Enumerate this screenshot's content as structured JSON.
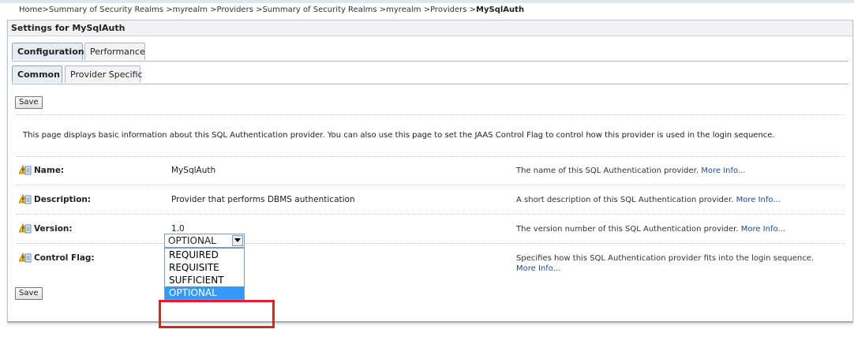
{
  "breadcrumb": {
    "items": [
      "Home",
      "Summary of Security Realms",
      "myrealm",
      "Providers",
      "Summary of Security Realms",
      "myrealm",
      "Providers"
    ],
    "separator": ">",
    "current": "MySqlAuth"
  },
  "panel": {
    "title": "Settings for MySqlAuth"
  },
  "tabs": {
    "primary": [
      {
        "label": "Configuration"
      },
      {
        "label": "Performance"
      }
    ],
    "secondary": [
      {
        "label": "Common"
      },
      {
        "label": "Provider Specific"
      }
    ]
  },
  "buttons": {
    "save_top": "Save",
    "save_bottom": "Save"
  },
  "intro": "This page displays basic information about this SQL Authentication provider. You can also use this page to set the JAAS Control Flag to control how this provider is used in the login sequence.",
  "fields": {
    "name": {
      "label": "Name:",
      "value": "MySqlAuth",
      "help": "The name of this SQL Authentication provider.",
      "more": "More Info..."
    },
    "description": {
      "label": "Description:",
      "value": "Provider that performs DBMS authentication",
      "help": "A short description of this SQL Authentication provider.",
      "more": "More Info..."
    },
    "version": {
      "label": "Version:",
      "value": "1.0",
      "help": "The version number of this SQL Authentication provider.",
      "more": "More Info..."
    },
    "control_flag": {
      "label": "Control Flag:",
      "selected": "OPTIONAL",
      "options": [
        "REQUIRED",
        "REQUISITE",
        "SUFFICIENT",
        "OPTIONAL"
      ],
      "help": "Specifies how this SQL Authentication provider fits into the login sequence.",
      "more": "More Info..."
    }
  },
  "icons": {
    "field_icon": "info-warning-icon",
    "dropdown_arrow": "chevron-down-icon"
  },
  "colors": {
    "link": "#1b4f8c",
    "selection": "#3399ff",
    "highlight": "#e01f26"
  }
}
